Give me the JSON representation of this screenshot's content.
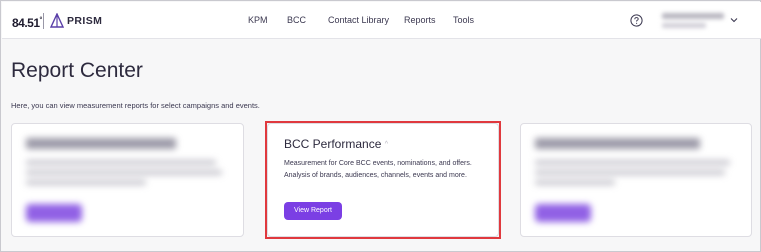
{
  "brand": {
    "logo_text": "84.51",
    "logo_mark": "°",
    "product": "PRISM"
  },
  "nav": {
    "items": [
      {
        "label": "KPM"
      },
      {
        "label": "BCC"
      },
      {
        "label": "Contact Library"
      },
      {
        "label": "Reports"
      },
      {
        "label": "Tools"
      }
    ]
  },
  "page": {
    "title": "Report Center",
    "subtitle": "Here, you can view measurement reports for select campaigns and events."
  },
  "cards": {
    "kpm": {
      "title": "KPM Campaign Performance",
      "blurred": true
    },
    "bcc": {
      "title": "BCC Performance",
      "mark": "^",
      "description": "Measurement for Core BCC events, nominations, and offers. Analysis of brands, audiences, channels, events and more.",
      "button_label": "View Report"
    },
    "direct": {
      "title": "Direct Connect Performance",
      "blurred": true
    }
  },
  "colors": {
    "accent": "#7b3fe4",
    "highlight": "#e0393e",
    "text": "#2d2a3e"
  }
}
